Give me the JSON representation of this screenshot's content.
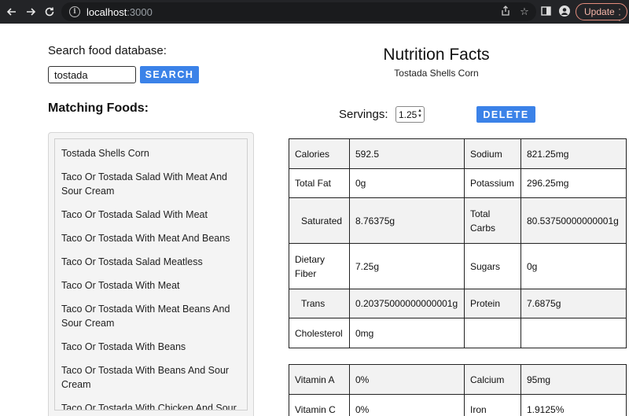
{
  "browser": {
    "url_host": "localhost",
    "url_port": ":3000",
    "update_label": "Update"
  },
  "search": {
    "label": "Search food database:",
    "value": "tostada",
    "button_label": "SEARCH"
  },
  "matching": {
    "title": "Matching Foods:",
    "items": [
      "Tostada Shells Corn",
      "Taco Or Tostada Salad With Meat And Sour Cream",
      "Taco Or Tostada Salad With Meat",
      "Taco Or Tostada With Meat And Beans",
      "Taco Or Tostada Salad Meatless",
      "Taco Or Tostada With Meat",
      "Taco Or Tostada With Meat Beans And Sour Cream",
      "Taco Or Tostada With Beans",
      "Taco Or Tostada With Beans And Sour Cream",
      "Taco Or Tostada With Chicken And Sour"
    ]
  },
  "nutrition": {
    "title": "Nutrition Facts",
    "food_name": "Tostada Shells Corn",
    "servings_label": "Servings:",
    "servings_value": "1.25",
    "delete_label": "DELETE",
    "rows": [
      {
        "l1": "Calories",
        "v1": "592.5",
        "l2": "Sodium",
        "v2": "821.25mg"
      },
      {
        "l1": "Total Fat",
        "v1": "0g",
        "l2": "Potassium",
        "v2": "296.25mg"
      },
      {
        "l1": "Saturated",
        "v1": "8.76375g",
        "l2": "Total Carbs",
        "v2": "80.53750000000001g"
      },
      {
        "l1": "Dietary Fiber",
        "v1": "7.25g",
        "l2": "Sugars",
        "v2": "0g"
      },
      {
        "l1": "Trans",
        "v1": "0.20375000000000001g",
        "l2": "Protein",
        "v2": "7.6875g"
      },
      {
        "l1": "Cholesterol",
        "v1": "0mg",
        "l2": "",
        "v2": ""
      }
    ],
    "vitamins": [
      {
        "l1": "Vitamin A",
        "v1": "0%",
        "l2": "Calcium",
        "v2": "95mg"
      },
      {
        "l1": "Vitamin C",
        "v1": "0%",
        "l2": "Iron",
        "v2": "1.9125%"
      }
    ]
  }
}
